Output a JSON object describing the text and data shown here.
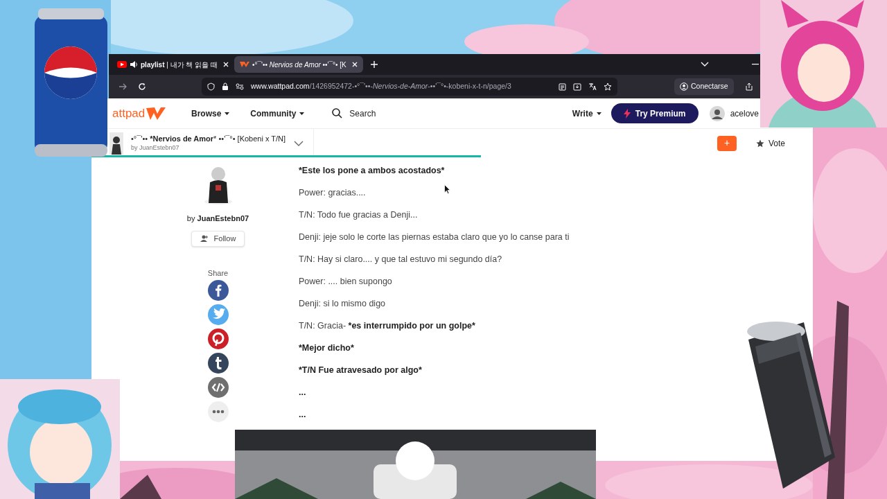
{
  "browser": {
    "tabs": [
      {
        "title": "**playlist** | 내가 책 읽을 때",
        "playing_audio": true,
        "selected": false
      },
      {
        "title": "•°¯'•• *Nervios de Amor* ••'¯°• [K",
        "playing_audio": false,
        "selected": true
      }
    ],
    "url_host": "www.wattpad.com",
    "url_path": "/1426952472-•°¯'••-*Nervios-de-Amor*-••'¯°•-kobeni-x-t-n/page/3",
    "account_button": "Conectarse"
  },
  "nav": {
    "logo_text": "attpad",
    "menus": [
      {
        "label": "Browse"
      },
      {
        "label": "Community"
      }
    ],
    "search": {
      "placeholder": "Search"
    },
    "write": "Write",
    "premium": "Try Premium",
    "user": "acelove"
  },
  "story": {
    "title": "•°¯'•• ***Nervios de Amor*** ••'¯°• [Kobeni x T/N]",
    "author": "by JuanEstebn07",
    "reading_progress": {
      "level": 0.54
    },
    "add_button": "+",
    "vote": "Vote"
  },
  "author_panel": {
    "byline": [
      {
        "text": "by ",
        "bold": false
      },
      {
        "text": "JuanEstebn07",
        "bold": true
      }
    ],
    "follow": "Follow",
    "share_label": "Share",
    "share": [
      {
        "kind": "facebook",
        "color": "#3b5998"
      },
      {
        "kind": "twitter",
        "color": "#55acee"
      },
      {
        "kind": "pinterest",
        "color": "#cb2027"
      },
      {
        "kind": "tumblr",
        "color": "#35465c"
      },
      {
        "kind": "embed",
        "color": "#6f6f6f"
      },
      {
        "kind": "more",
        "color": "#eeeeee"
      }
    ]
  },
  "paragraphs": [
    [
      {
        "text": "*Este los pone a ambos acostados*",
        "bold": true
      }
    ],
    [
      {
        "text": "Power: gracias....",
        "bold": false
      }
    ],
    [
      {
        "text": "T/N: Todo fue gracias a Denji...",
        "bold": false
      }
    ],
    [
      {
        "text": "Denji: jeje solo le corte las piernas estaba claro que yo lo canse para ti",
        "bold": false
      }
    ],
    [
      {
        "text": "T/N: Hay si claro.... y que tal estuvo mi segundo día?",
        "bold": false
      }
    ],
    [
      {
        "text": "Power: .... bien supongo",
        "bold": false
      }
    ],
    [
      {
        "text": "Denji: si lo mismo digo",
        "bold": false
      }
    ],
    [
      {
        "text": "T/N:  Gracia- ",
        "bold": false
      },
      {
        "text": "*es interrumpido por un golpe*",
        "bold": true
      }
    ],
    [
      {
        "text": "*Mejor dicho*",
        "bold": true
      }
    ],
    [
      {
        "text": "*T/N Fue atravesado por algo*",
        "bold": true
      }
    ],
    [
      {
        "text": "...",
        "bold": true
      }
    ],
    [
      {
        "text": "...",
        "bold": true
      }
    ]
  ]
}
